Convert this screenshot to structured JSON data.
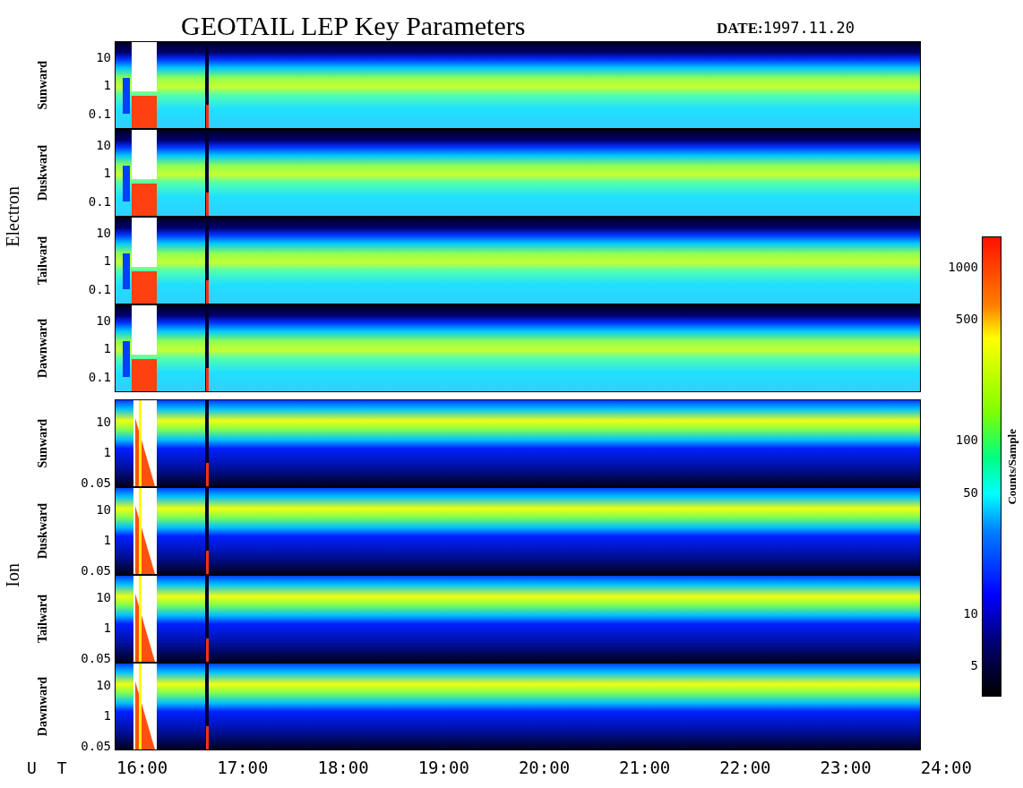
{
  "title": "GEOTAIL LEP Key Parameters",
  "date": {
    "label": "DATE:",
    "value": "1997.11.20"
  },
  "groups": [
    {
      "name": "Electron",
      "kind": "electron",
      "panels": [
        {
          "label": "Sunward",
          "yticks": [
            "10",
            "1",
            "0.1"
          ]
        },
        {
          "label": "Duskward",
          "yticks": [
            "10",
            "1",
            "0.1"
          ]
        },
        {
          "label": "Tailward",
          "yticks": [
            "10",
            "1",
            "0.1"
          ]
        },
        {
          "label": "Dawnward",
          "yticks": [
            "10",
            "1",
            "0.1"
          ]
        }
      ]
    },
    {
      "name": "Ion",
      "kind": "ion",
      "panels": [
        {
          "label": "Sunward",
          "yticks": [
            "10",
            "1",
            "0.05"
          ]
        },
        {
          "label": "Duskward",
          "yticks": [
            "10",
            "1",
            "0.05"
          ]
        },
        {
          "label": "Tailward",
          "yticks": [
            "10",
            "1",
            "0.05"
          ]
        },
        {
          "label": "Dawnward",
          "yticks": [
            "10",
            "1",
            "0.05"
          ]
        }
      ]
    }
  ],
  "x_axis": {
    "label": "U T",
    "ticks": [
      "16:00",
      "17:00",
      "18:00",
      "19:00",
      "20:00",
      "21:00",
      "22:00",
      "23:00",
      "24:00"
    ]
  },
  "colorbar": {
    "label": "Counts/Sample",
    "ticks": [
      "1000",
      "500",
      "100",
      "50",
      "10",
      "5"
    ]
  }
}
